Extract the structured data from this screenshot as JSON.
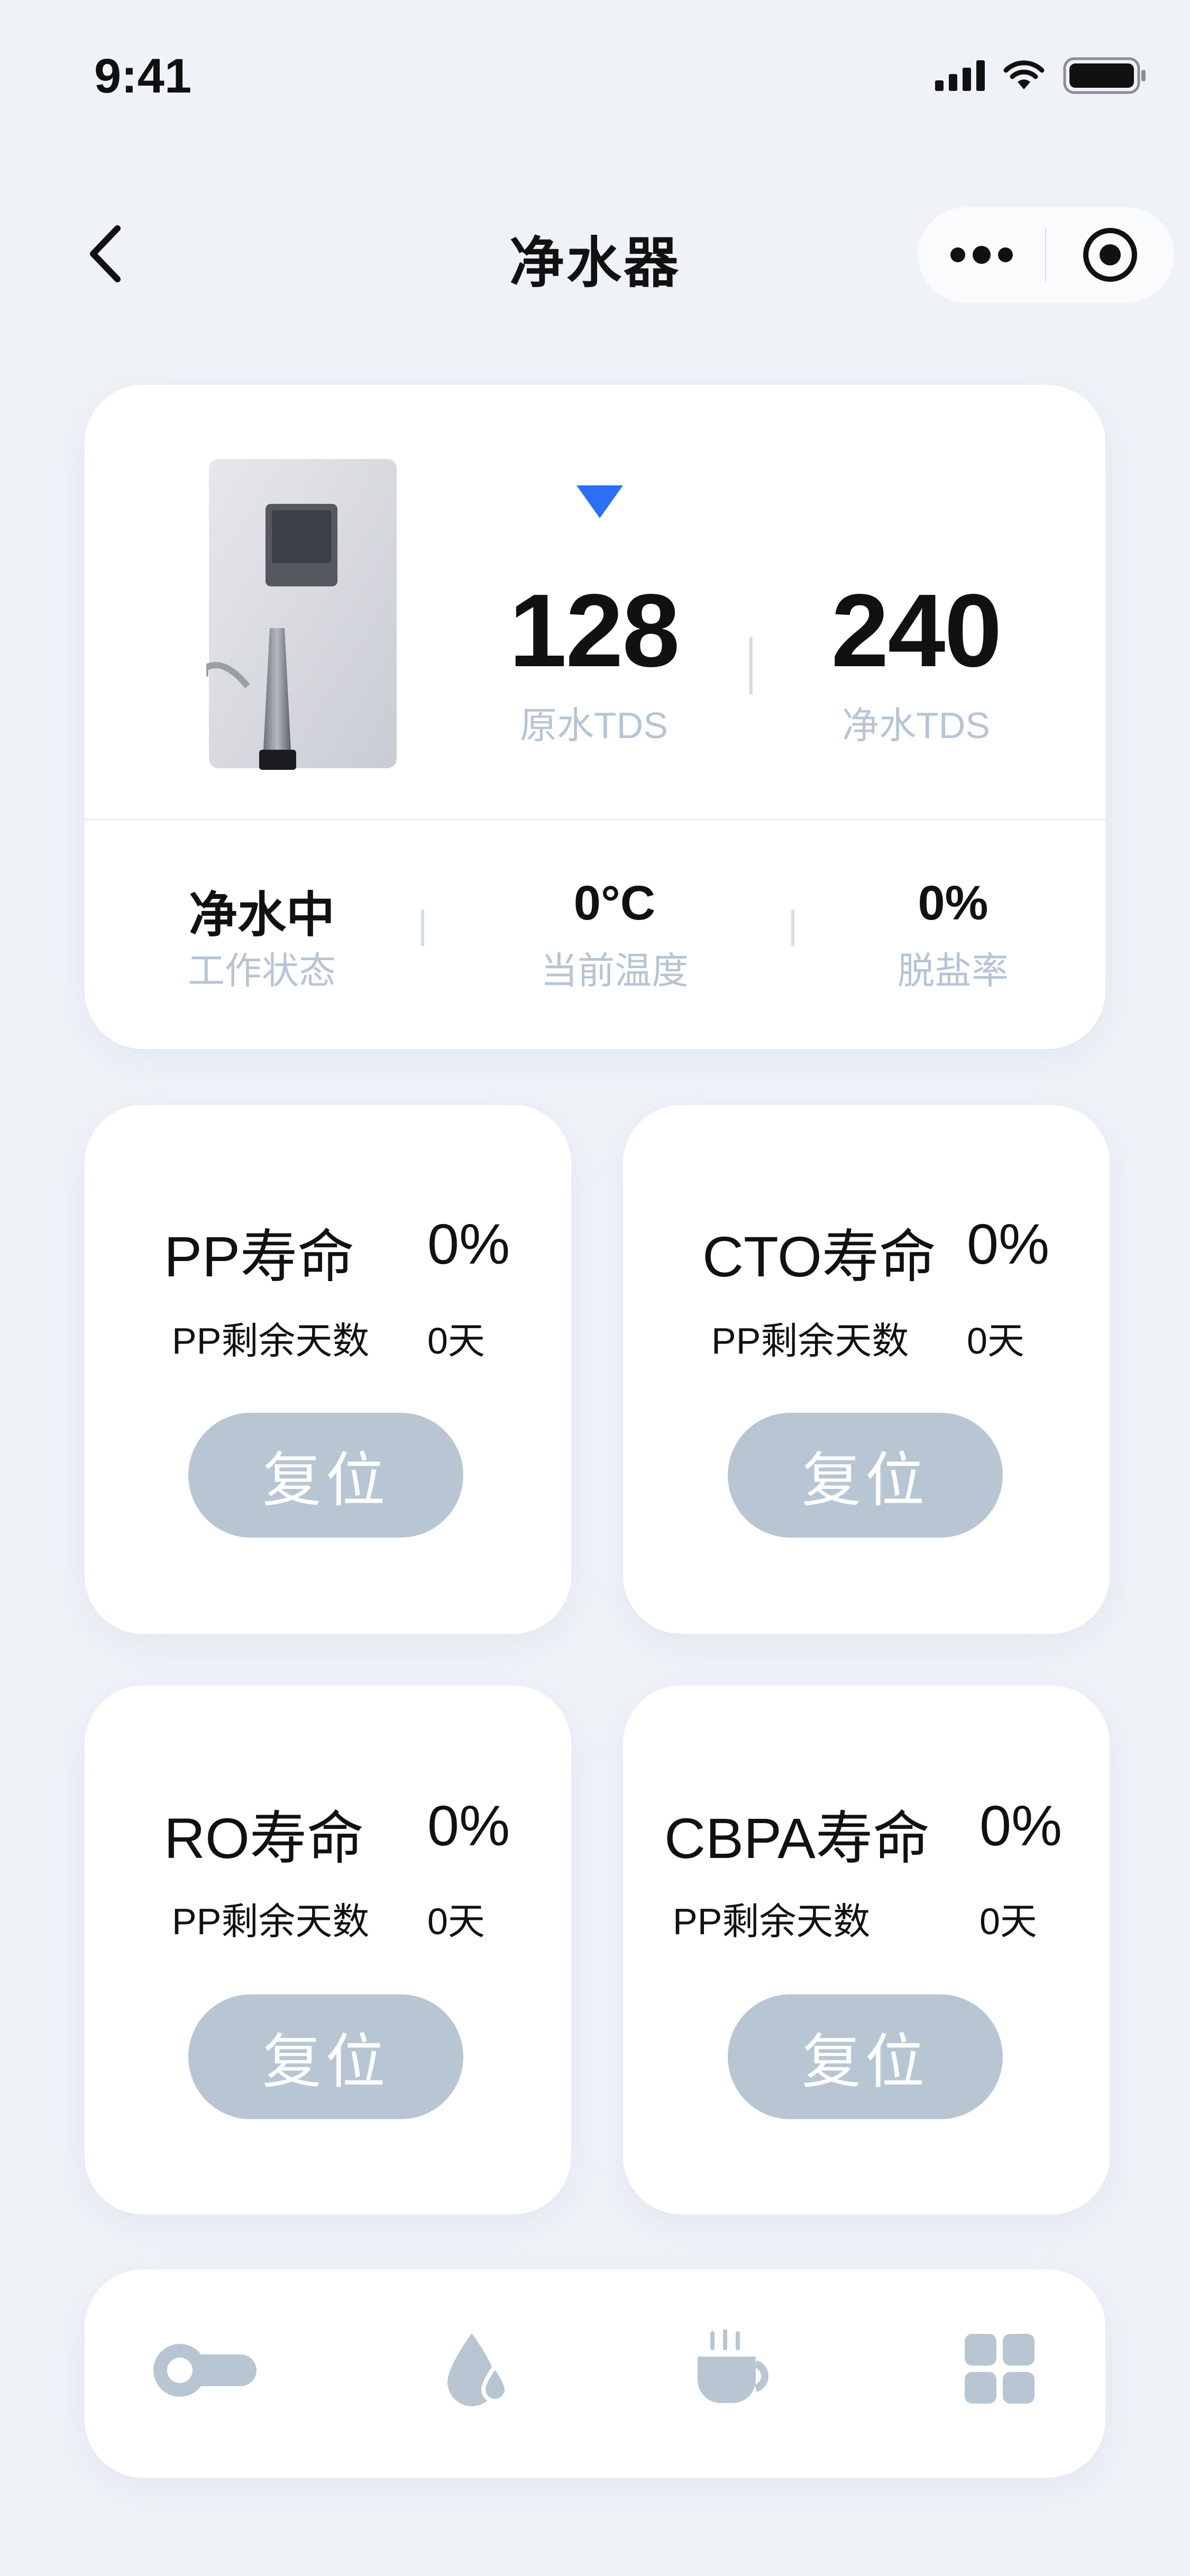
{
  "status_bar": {
    "time": "9:41"
  },
  "nav": {
    "title": "净水器"
  },
  "device": {
    "raw_tds_value": "128",
    "raw_tds_label": "原水TDS",
    "pure_tds_value": "240",
    "pure_tds_label": "净水TDS",
    "stats": [
      {
        "value": "净水中",
        "label": "工作状态"
      },
      {
        "value": "0°C",
        "label": "当前温度"
      },
      {
        "value": "0%",
        "label": "脱盐率"
      }
    ]
  },
  "filters": [
    {
      "title": "PP寿命",
      "percent": "0%",
      "days_label": "PP剩余天数",
      "days_value": "0天",
      "reset_label": "复位"
    },
    {
      "title": "CTO寿命",
      "percent": "0%",
      "days_label": "PP剩余天数",
      "days_value": "0天",
      "reset_label": "复位"
    },
    {
      "title": "RO寿命",
      "percent": "0%",
      "days_label": "PP剩余天数",
      "days_value": "0天",
      "reset_label": "复位"
    },
    {
      "title": "CBPA寿命",
      "percent": "0%",
      "days_label": "PP剩余天数",
      "days_value": "0天",
      "reset_label": "复位"
    }
  ],
  "tabbar": {
    "items": [
      {
        "icon": "toggle-icon"
      },
      {
        "icon": "water-drops-icon"
      },
      {
        "icon": "hot-cup-icon"
      },
      {
        "icon": "grid-icon"
      }
    ]
  },
  "colors": {
    "background": "#eff3f8",
    "accent": "#2c6ff6",
    "muted": "#b6c5d4",
    "button": "#b8c6d3"
  }
}
